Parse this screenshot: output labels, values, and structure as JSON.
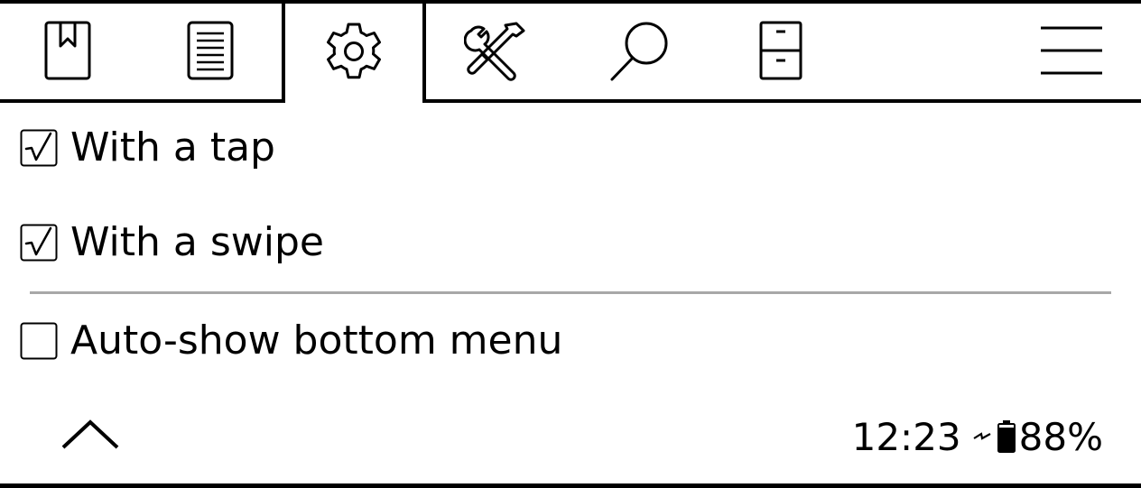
{
  "tabs": [
    {
      "icon": "bookmark-icon",
      "active": false
    },
    {
      "icon": "document-icon",
      "active": false
    },
    {
      "icon": "gear-icon",
      "active": true
    },
    {
      "icon": "tools-icon",
      "active": false
    },
    {
      "icon": "search-icon",
      "active": false
    },
    {
      "icon": "file-cabinet-icon",
      "active": false
    },
    {
      "icon": "hamburger-menu-icon",
      "active": false
    }
  ],
  "settings": {
    "items": [
      {
        "label": "With a tap",
        "checked": true
      },
      {
        "label": "With a swipe",
        "checked": true
      },
      {
        "label": "Auto-show bottom menu",
        "checked": false
      }
    ]
  },
  "status_bar": {
    "time": "12:23",
    "battery_percent": "88%",
    "battery_level": 0.88,
    "charging_icon": "charging-bolt-icon",
    "battery_icon": "battery-icon"
  },
  "colors": {
    "foreground": "#000000",
    "background": "#ffffff",
    "divider": "#a8a8a8"
  }
}
